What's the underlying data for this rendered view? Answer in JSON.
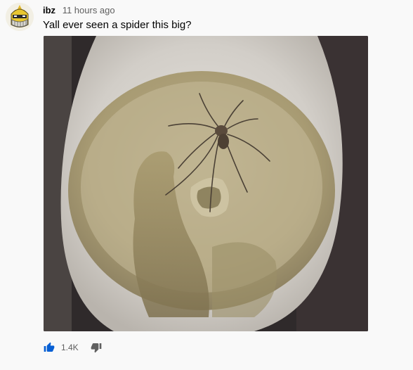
{
  "comment": {
    "author": "ibz",
    "timestamp": "11 hours ago",
    "text": "Yall ever seen a spider this big?",
    "likes": "1.4K",
    "avatar_icon": "knight-helmet-avatar",
    "attachment": "spider-in-toilet-photo"
  },
  "actions": {
    "like_icon": "thumbs-up-icon",
    "dislike_icon": "thumbs-down-icon"
  },
  "colors": {
    "accent": "#065fd4",
    "author": "#030303",
    "secondary_text": "#606060",
    "background": "#f9f9f9"
  }
}
